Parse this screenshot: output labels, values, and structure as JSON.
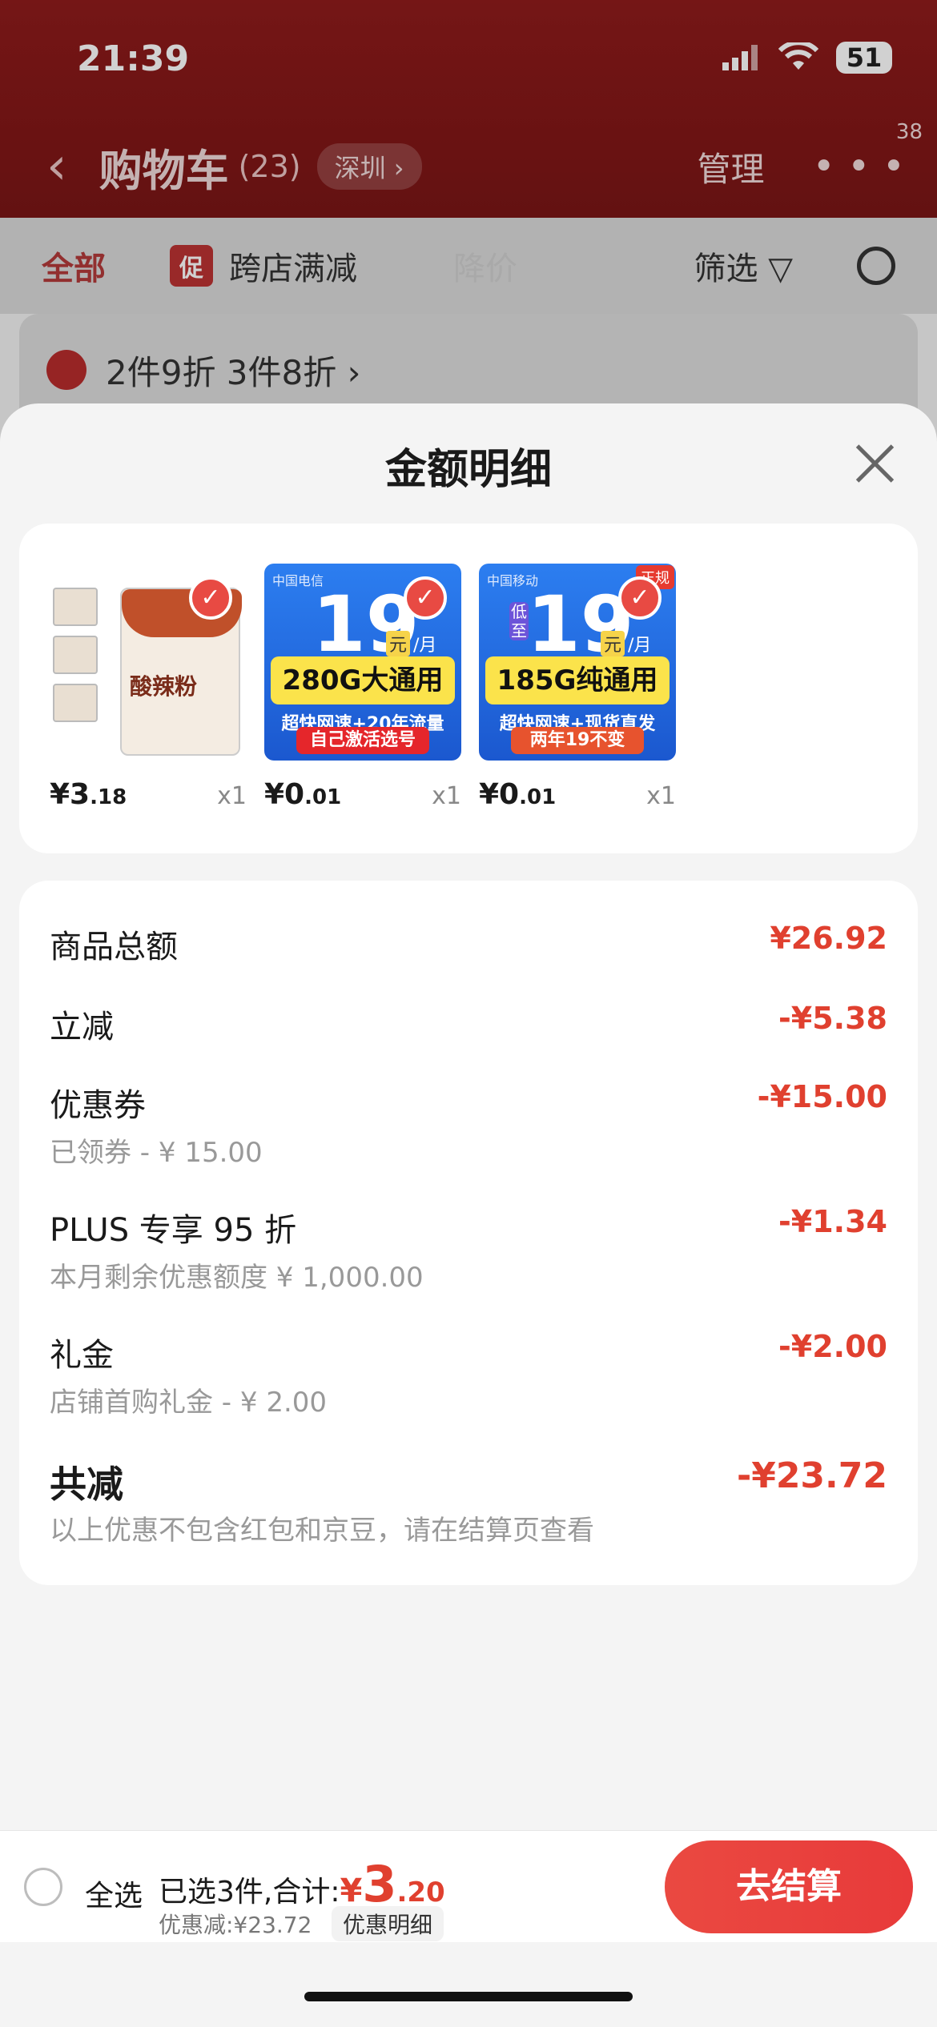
{
  "status_bar": {
    "time": "21:39",
    "battery": "51"
  },
  "header": {
    "back_glyph": "‹",
    "title": "购物车",
    "count": "(23)",
    "city": "深圳 ›",
    "manage": "管理",
    "more_glyph": "• • •",
    "badge": "38"
  },
  "filters": {
    "all": "全部",
    "promo_tag": "促",
    "cross_store": "跨店满减",
    "price_drop": "降价",
    "filter": "筛选"
  },
  "background_card": {
    "text": "2件9折 3件8折 ›"
  },
  "sheet": {
    "title": "金额明细",
    "goods": [
      {
        "price_main": "¥3",
        "price_decimal": ".18",
        "qty": "x1",
        "label": "酸辣粉"
      },
      {
        "price_main": "¥0",
        "price_decimal": ".01",
        "qty": "x1",
        "big": "19",
        "yuan": "元",
        "per": "/月",
        "band": "280G大通用",
        "sub": "超快网速+20年流量",
        "foot": "自己激活选号",
        "logo": "中国电信"
      },
      {
        "price_main": "¥0",
        "price_decimal": ".01",
        "qty": "x1",
        "big": "19",
        "yuan": "元",
        "per": "/月",
        "band": "185G纯通用",
        "sub": "超快网速+现货直发",
        "foot": "两年19不变",
        "logo": "中国移动",
        "tag": "正规",
        "low": "低至"
      }
    ],
    "details": {
      "goods_total_label": "商品总额",
      "goods_total_value": "¥26.92",
      "instant_label": "立减",
      "instant_value": "-¥5.38",
      "coupon_label": "优惠券",
      "coupon_value": "-¥15.00",
      "coupon_note": "已领券 - ¥ 15.00",
      "plus_label": "PLUS 专享 95 折",
      "plus_value": "-¥1.34",
      "plus_note": "本月剩余优惠额度 ¥ 1,000.00",
      "gift_label": "礼金",
      "gift_value": "-¥2.00",
      "gift_note": "店铺首购礼金 - ¥ 2.00",
      "total_label": "共减",
      "total_value": "-¥23.72",
      "total_note": "以上优惠不包含红包和京豆，请在结算页查看"
    }
  },
  "bottom_bar": {
    "select_all": "全选",
    "summary_prefix": "已选3件,合计:",
    "yen": "¥",
    "amount_main": "3",
    "amount_decimal": ".20",
    "discount": "优惠减:¥23.72",
    "discount_detail": "优惠明细",
    "checkout": "去结算"
  }
}
